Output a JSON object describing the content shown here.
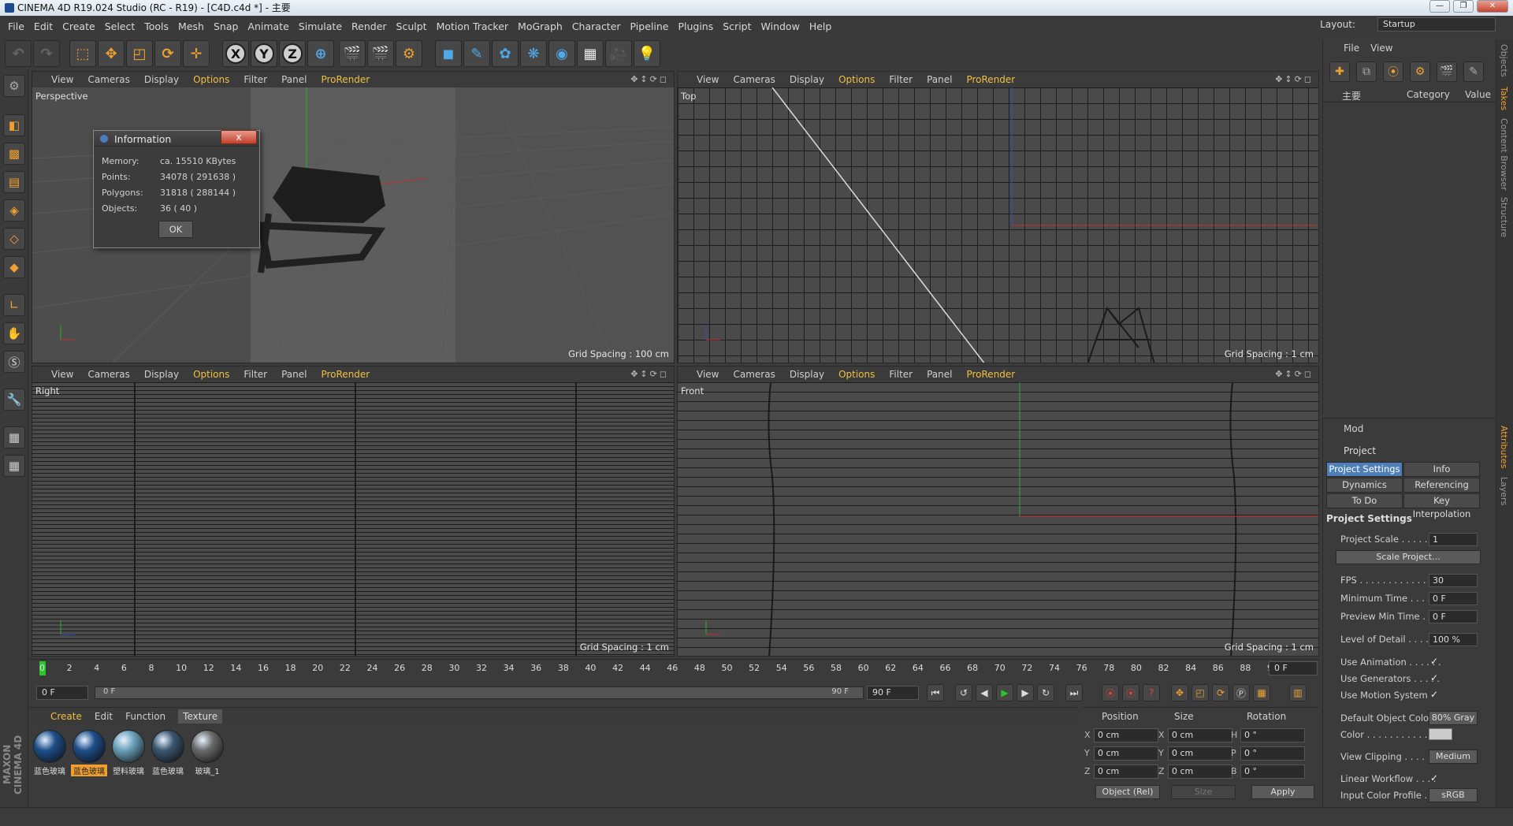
{
  "window": {
    "title": "CINEMA 4D R19.024 Studio (RC - R19) - [C4D.c4d *] - 主要"
  },
  "menubar": [
    "File",
    "Edit",
    "Create",
    "Select",
    "Tools",
    "Mesh",
    "Snap",
    "Animate",
    "Simulate",
    "Render",
    "Sculpt",
    "Motion Tracker",
    "MoGraph",
    "Character",
    "Pipeline",
    "Plugins",
    "Script",
    "Window",
    "Help"
  ],
  "layout": {
    "label": "Layout:",
    "value": "Startup"
  },
  "toolbar": {
    "axis_x": "X",
    "axis_y": "Y",
    "axis_z": "Z"
  },
  "viewports": [
    {
      "name": "Perspective",
      "menu": [
        "View",
        "Cameras",
        "Display",
        "Options",
        "Filter",
        "Panel",
        "ProRender"
      ],
      "grid": "Grid Spacing : 100 cm"
    },
    {
      "name": "Top",
      "menu": [
        "View",
        "Cameras",
        "Display",
        "Options",
        "Filter",
        "Panel",
        "ProRender"
      ],
      "grid": "Grid Spacing : 1 cm"
    },
    {
      "name": "Right",
      "menu": [
        "View",
        "Cameras",
        "Display",
        "Options",
        "Filter",
        "Panel",
        "ProRender"
      ],
      "grid": "Grid Spacing : 1 cm"
    },
    {
      "name": "Front",
      "menu": [
        "View",
        "Cameras",
        "Display",
        "Options",
        "Filter",
        "Panel",
        "ProRender"
      ],
      "grid": "Grid Spacing : 1 cm"
    }
  ],
  "info_dialog": {
    "title": "Information",
    "close": "x",
    "rows": [
      {
        "label": "Memory:",
        "value": "ca. 15510 KBytes"
      },
      {
        "label": "Points:",
        "value": "34078 ( 291638 )"
      },
      {
        "label": "Polygons:",
        "value": "31818 ( 288144 )"
      },
      {
        "label": "Objects:",
        "value": "36 ( 40 )"
      }
    ],
    "ok": "OK"
  },
  "timeline": {
    "ticks": [
      "0",
      "2",
      "4",
      "6",
      "8",
      "10",
      "12",
      "14",
      "16",
      "18",
      "20",
      "22",
      "24",
      "26",
      "28",
      "30",
      "32",
      "34",
      "36",
      "38",
      "40",
      "42",
      "44",
      "46",
      "48",
      "50",
      "52",
      "54",
      "56",
      "58",
      "60",
      "62",
      "64",
      "66",
      "68",
      "70",
      "72",
      "74",
      "76",
      "78",
      "80",
      "82",
      "84",
      "86",
      "88",
      "90"
    ],
    "end_frame": "0 F"
  },
  "transport": {
    "current": "0 F",
    "slider_start": "0 F",
    "slider_end": "90 F",
    "max": "90 F"
  },
  "materials": {
    "menu": [
      "Create",
      "Edit",
      "Function",
      "Texture"
    ],
    "items": [
      {
        "label": "蓝色玻璃",
        "selected": false,
        "color": "#1f4f8a"
      },
      {
        "label": "蓝色玻璃",
        "selected": true,
        "color": "#1f4f8a"
      },
      {
        "label": "塑料玻璃",
        "selected": false,
        "color": "#6aa0b8"
      },
      {
        "label": "蓝色玻璃",
        "selected": false,
        "color": "#3a5670"
      },
      {
        "label": "玻璃_1",
        "selected": false,
        "color": "#6a6a6a"
      }
    ]
  },
  "coordinates": {
    "headers": [
      "Position",
      "Size",
      "Rotation"
    ],
    "rows": [
      {
        "a1": "X",
        "v1": "0 cm",
        "a2": "X",
        "v2": "0 cm",
        "a3": "H",
        "v3": "0 °"
      },
      {
        "a1": "Y",
        "v1": "0 cm",
        "a2": "Y",
        "v2": "0 cm",
        "a3": "P",
        "v3": "0 °"
      },
      {
        "a1": "Z",
        "v1": "0 cm",
        "a2": "Z",
        "v2": "0 cm",
        "a3": "B",
        "v3": "0 °"
      }
    ],
    "mode": "Object (Rel)",
    "size": "Size",
    "apply": "Apply"
  },
  "object_manager": {
    "menu": [
      "File",
      "View"
    ],
    "columns": [
      "主要",
      "Category",
      "Value"
    ]
  },
  "side_tabs": [
    "Objects",
    "Takes",
    "Content Browser",
    "Structure",
    "Attributes",
    "Layers"
  ],
  "attributes": {
    "mode": "Mod",
    "object": "Project",
    "tabs": [
      "Project Settings",
      "Info",
      "Dynamics",
      "Referencing",
      "To Do",
      "Key Interpolation"
    ],
    "section": "Project Settings",
    "props": [
      {
        "label": "Project Scale . . . . . .",
        "value": "1"
      },
      {
        "label": "FPS . . . . . . . . . . . . . .",
        "value": "30"
      },
      {
        "label": "Minimum Time . . . . . .",
        "value": "0 F"
      },
      {
        "label": "Preview Min Time . . . .",
        "value": "0 F"
      },
      {
        "label": "Level of Detail . . . . . .",
        "value": "100 %"
      }
    ],
    "scale_button": "Scale Project...",
    "checks": [
      {
        "label": "Use Animation . . . . . .",
        "value": "✓"
      },
      {
        "label": "Use Generators . . . . .",
        "value": "✓"
      },
      {
        "label": "Use Motion System",
        "value": "✓"
      }
    ],
    "default_color_label": "Default Object Color",
    "default_color_value": "80% Gray",
    "color_label": "Color . . . . . . . . . . . . .",
    "clipping_label": "View Clipping . . . . . .",
    "clipping_value": "Medium",
    "linear_label": "Linear Workflow . . . .",
    "linear_value": "✓",
    "profile_label": "Input Color Profile . .",
    "profile_value": "sRGB"
  },
  "branding": {
    "maxon": "MAXON CINEMA 4D"
  }
}
